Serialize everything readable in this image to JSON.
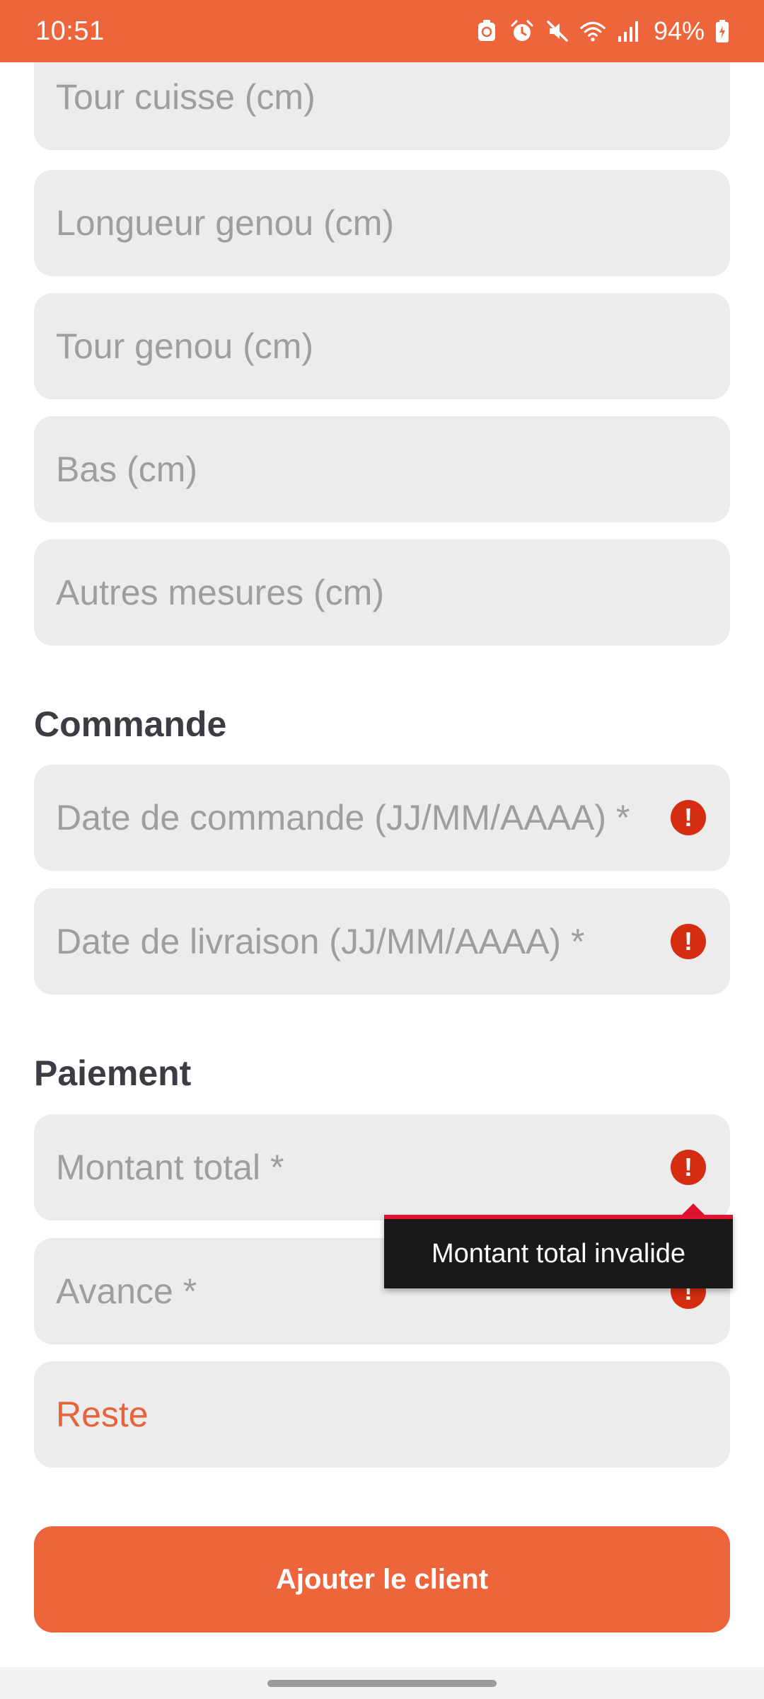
{
  "status_bar": {
    "time": "10:51",
    "battery": "94%",
    "icons": [
      "sync-icon",
      "alarm-icon",
      "mute-icon",
      "wifi-icon",
      "signal-icon",
      "battery-charging-icon"
    ],
    "background": "#ee653b"
  },
  "measurements": {
    "tour_cuisse": "Tour cuisse (cm)",
    "longueur_genou": "Longueur genou (cm)",
    "tour_genou": "Tour genou (cm)",
    "bas": "Bas (cm)",
    "autres": "Autres mesures (cm)"
  },
  "commande": {
    "title": "Commande",
    "date_commande": "Date de commande (JJ/MM/AAAA) *",
    "date_livraison": "Date de livraison (JJ/MM/AAAA) *"
  },
  "paiement": {
    "title": "Paiement",
    "montant_total": "Montant total *",
    "avance": "Avance *",
    "reste": "Reste",
    "tooltip": "Montant total invalide"
  },
  "actions": {
    "submit_label": "Ajouter le client"
  },
  "colors": {
    "accent": "#ee653b",
    "error": "#d52d12",
    "field_background": "#ececec",
    "placeholder": "#9e9e9e"
  }
}
